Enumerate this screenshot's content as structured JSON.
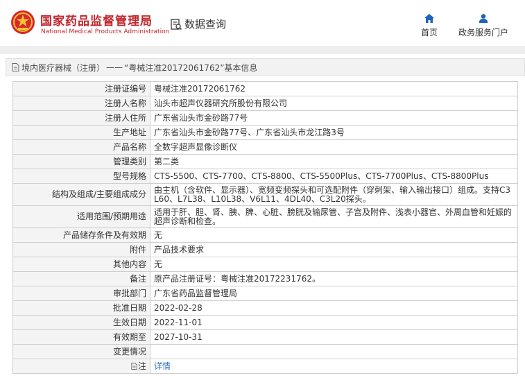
{
  "header": {
    "site_title": "国家药品监督管理局",
    "site_subtitle": "National Medical Products Administration",
    "query_label": "数据查询",
    "nav": [
      {
        "label": "首页",
        "icon": "home-icon"
      },
      {
        "label": "政务服务门户",
        "icon": "user-icon"
      }
    ]
  },
  "breadcrumb": {
    "icon": "document-icon",
    "category": "境内医疗器械（注册）",
    "separator": "——",
    "title": "“粤械注准20172061762”基本信息"
  },
  "fields": [
    {
      "label": "注册证编号",
      "value": "粤械注准20172061762"
    },
    {
      "label": "注册人名称",
      "value": "汕头市超声仪器研究所股份有限公司"
    },
    {
      "label": "注册人住所",
      "value": "广东省汕头市金砂路77号"
    },
    {
      "label": "生产地址",
      "value": "广东省汕头市金砂路77号、广东省汕头市龙江路3号"
    },
    {
      "label": "产品名称",
      "value": "全数字超声显像诊断仪"
    },
    {
      "label": "管理类别",
      "value": "第二类"
    },
    {
      "label": "型号规格",
      "value": "CTS-5500、CTS-7700、CTS-8800、CTS-5500Plus、CTS-7700Plus、CTS-8800Plus"
    },
    {
      "label": "结构及组成/主要组成成分",
      "value": "由主机（含软件、显示器）、宽频变频探头和可选配附件（穿刺架、输入输出接口）组成。支持C3L60、L7L38、L10L38、V6L11、4DL40、C3L20探头。"
    },
    {
      "label": "适用范围/预期用途",
      "value": "适用于肝、胆、肾、胰、脾、心脏、膀胱及输尿管、子宫及附件、浅表小器官、外周血管和妊娠的超声诊断和检查。"
    },
    {
      "label": "产品储存条件及有效期",
      "value": "无"
    },
    {
      "label": "附件",
      "value": "产品技术要求"
    },
    {
      "label": "其他内容",
      "value": "无"
    },
    {
      "label": "备注",
      "value": "原产品注册证号：粤械注准20172231762。"
    },
    {
      "label": "审批部门",
      "value": "广东省药品监督管理局"
    },
    {
      "label": "批准日期",
      "value": "2022-02-28"
    },
    {
      "label": "生效日期",
      "value": "2022-11-01"
    },
    {
      "label": "有效期至",
      "value": "2027-10-31"
    },
    {
      "label": "变更情况",
      "value": ""
    },
    {
      "label": "注",
      "value": "详情"
    }
  ],
  "colors": {
    "brand_red": "#c0262d",
    "link_blue": "#2a6fbf",
    "nav_blue": "#1f64b8"
  }
}
